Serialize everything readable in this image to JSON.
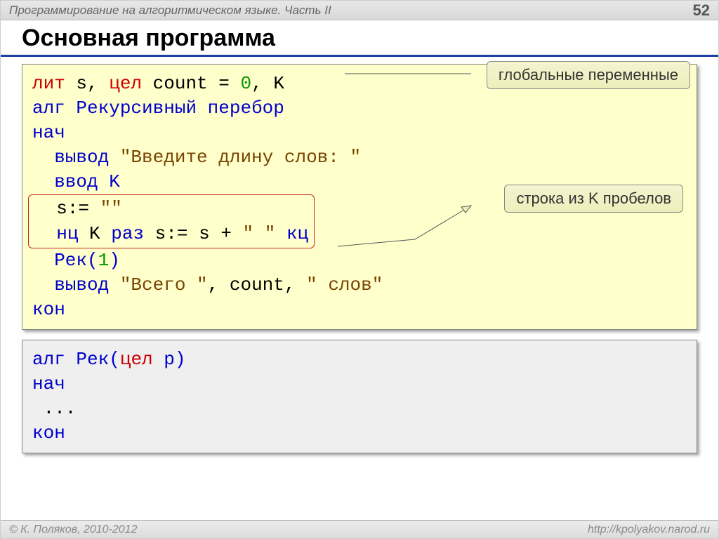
{
  "header": {
    "subject": "Программирование на алгоритмическом языке. Часть II",
    "page": "52"
  },
  "title": "Основная программа",
  "callouts": {
    "c1": "глобальные переменные",
    "c2": "строка из K пробелов"
  },
  "code1": {
    "l1a": "лит",
    "l1b": " s, ",
    "l1c": "цел",
    "l1d": " count",
    "l1e": "=",
    "l1f": "0",
    "l1g": ", K",
    "l2a": "алг ",
    "l2b": "Рекурсивный перебор",
    "l3": "нач",
    "l4a": "  вывод ",
    "l4b": "\"Введите длину слов: \"",
    "l5": "  ввод K",
    "l6a": "  s:=",
    "l6b": "\"\"",
    "l7a": "нц",
    "l7b": " K ",
    "l7c": "раз",
    "l7d": " s:=",
    "l7e": "s",
    "l7f": "+",
    "l7g": "\" \"",
    "l7h": " кц",
    "l8a": "  Рек(",
    "l8b": "1",
    "l8c": ")",
    "l9a": "  вывод ",
    "l9b": "\"Всего \"",
    "l9c": ",",
    "l9d": "count",
    "l9e": ",",
    "l9f": "\" слов\"",
    "l10": "кон"
  },
  "code2": {
    "l1a": "алг ",
    "l1b": "Рек(",
    "l1c": "цел",
    "l1d": " p)",
    "l2": "нач",
    "l3": " ...",
    "l4": "кон"
  },
  "footer": {
    "left": "© К. Поляков, 2010-2012",
    "right": "http://kpolyakov.narod.ru"
  }
}
